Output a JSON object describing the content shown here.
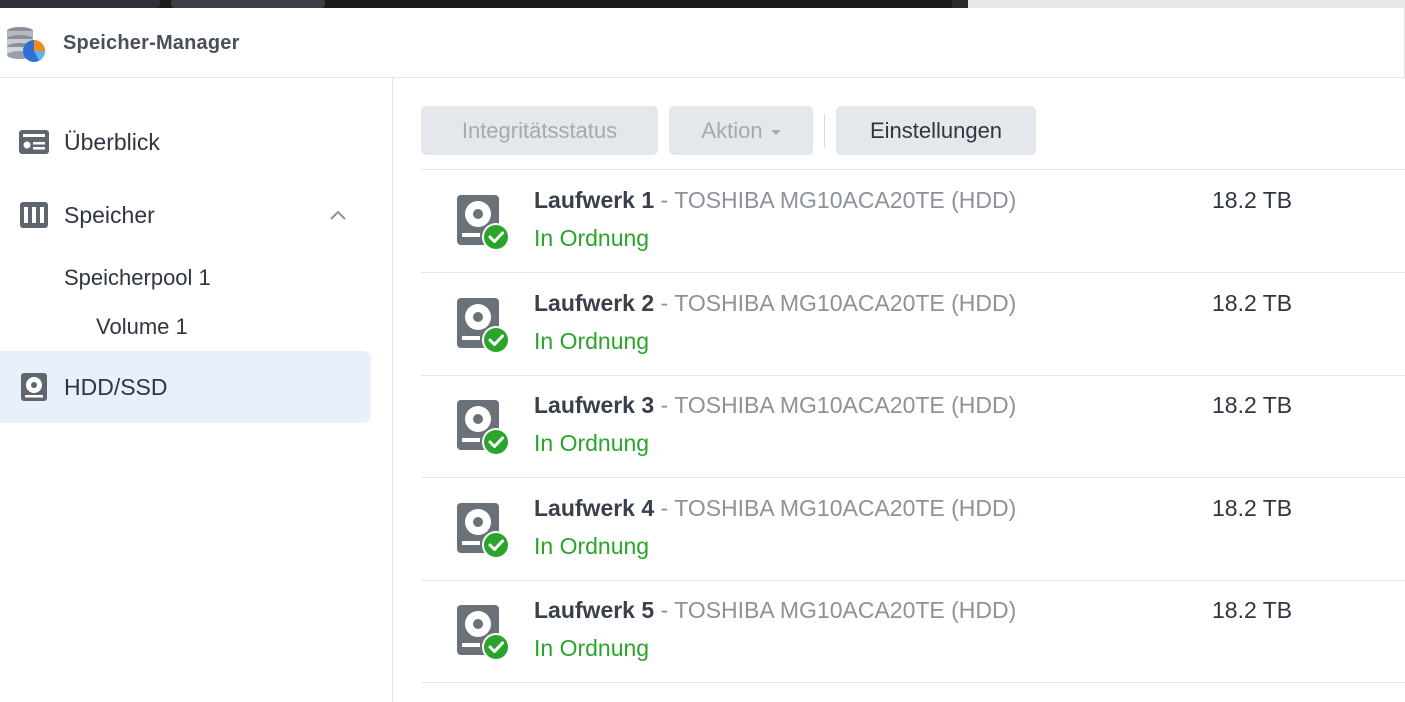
{
  "app": {
    "title": "Speicher-Manager"
  },
  "sidebar": {
    "items": [
      {
        "label": "Überblick",
        "icon": "overview-icon"
      },
      {
        "label": "Speicher",
        "icon": "storage-icon",
        "expanded": true
      },
      {
        "label": "HDD/SSD",
        "icon": "hdd-icon",
        "active": true
      }
    ],
    "storage_children": [
      {
        "label": "Speicherpool 1"
      },
      {
        "label": "Volume 1"
      }
    ]
  },
  "toolbar": {
    "health_label": "Integritätsstatus",
    "action_label": "Aktion",
    "settings_label": "Einstellungen"
  },
  "drives": [
    {
      "name": "Laufwerk 1",
      "separator": " - ",
      "model": "TOSHIBA MG10ACA20TE (HDD)",
      "status": "In Ordnung",
      "size": "18.2 TB"
    },
    {
      "name": "Laufwerk 2",
      "separator": " - ",
      "model": "TOSHIBA MG10ACA20TE (HDD)",
      "status": "In Ordnung",
      "size": "18.2 TB"
    },
    {
      "name": "Laufwerk 3",
      "separator": " - ",
      "model": "TOSHIBA MG10ACA20TE (HDD)",
      "status": "In Ordnung",
      "size": "18.2 TB"
    },
    {
      "name": "Laufwerk 4",
      "separator": " - ",
      "model": "TOSHIBA MG10ACA20TE (HDD)",
      "status": "In Ordnung",
      "size": "18.2 TB"
    },
    {
      "name": "Laufwerk 5",
      "separator": " - ",
      "model": "TOSHIBA MG10ACA20TE (HDD)",
      "status": "In Ordnung",
      "size": "18.2 TB"
    }
  ],
  "colors": {
    "status_ok": "#2aa52a",
    "active_nav_bg": "#e8f0fc",
    "button_bg": "#e4e8ed"
  }
}
